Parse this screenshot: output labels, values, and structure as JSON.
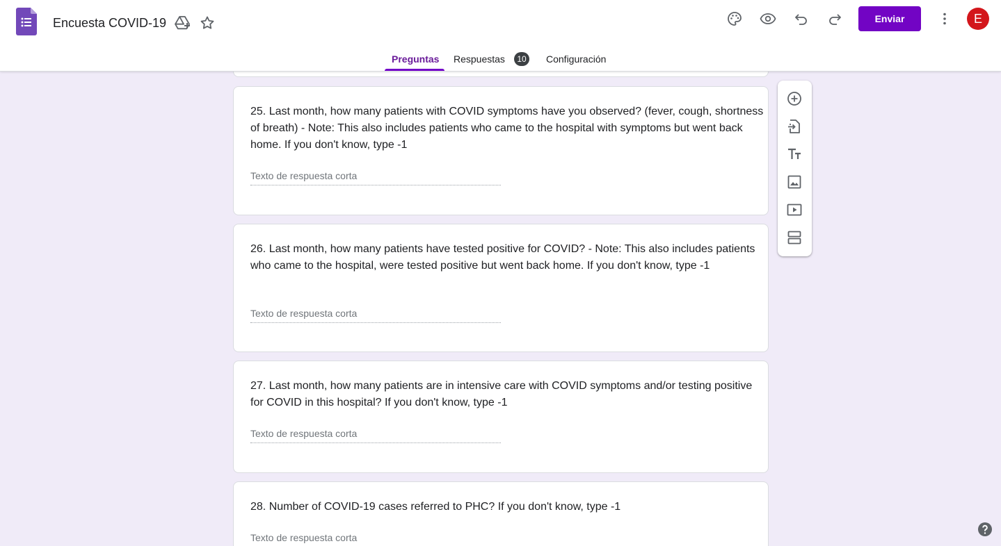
{
  "app": {
    "title": "Encuesta COVID-19",
    "accent_color": "#7204c4"
  },
  "header": {
    "send_label": "Enviar",
    "avatar_letter": "E",
    "icons": [
      "palette-icon",
      "preview-eye-icon",
      "undo-icon",
      "redo-icon",
      "more-vert-icon"
    ]
  },
  "tabs": [
    {
      "label": "Preguntas",
      "active": true
    },
    {
      "label": "Respuestas",
      "badge": "10"
    },
    {
      "label": "Configuración"
    }
  ],
  "questions": [
    {
      "title": "25. Last month, how many patients with COVID symptoms have you observed? (fever, cough, shortness of breath) - Note: This also includes patients who came to the hospital with symptoms but went back home. If you don't know, type -1",
      "placeholder": "Texto de respuesta corta"
    },
    {
      "title": "26. Last month, how many patients have tested positive for COVID? - Note: This also includes patients who came to the hospital, were tested positive but went back home. If you don't know, type -1",
      "placeholder": "Texto de respuesta corta"
    },
    {
      "title": "27. Last month, how many patients are in intensive care with COVID symptoms and/or testing positive for COVID in this hospital? If you don't know, type -1",
      "placeholder": "Texto de respuesta corta"
    },
    {
      "title": "28. Number of COVID-19 cases referred to PHC? If you don't know, type -1",
      "placeholder": "Texto de respuesta corta"
    }
  ],
  "toolbar": {
    "items": [
      "add-question-icon",
      "import-questions-icon",
      "add-title-icon",
      "add-image-icon",
      "add-video-icon",
      "add-section-icon"
    ]
  }
}
